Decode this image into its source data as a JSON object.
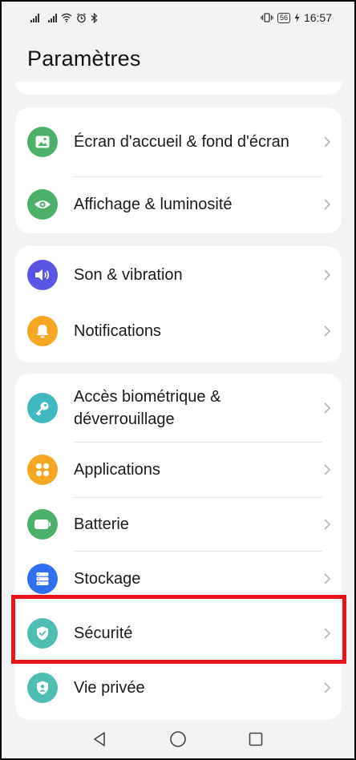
{
  "status_bar": {
    "battery_level": "56",
    "time": "16:57"
  },
  "header": {
    "title": "Paramètres"
  },
  "groups": [
    {
      "items": [
        {
          "label": "Écran d'accueil & fond d'écran",
          "icon": "wallpaper-icon",
          "color": "#4caf6a"
        },
        {
          "label": "Affichage & luminosité",
          "icon": "eye-icon",
          "color": "#4caf6a"
        }
      ]
    },
    {
      "items": [
        {
          "label": "Son & vibration",
          "icon": "speaker-icon",
          "color": "#5b55e6"
        },
        {
          "label": "Notifications",
          "icon": "bell-icon",
          "color": "#f5a623"
        }
      ]
    },
    {
      "items": [
        {
          "label": "Accès biométrique & déverrouillage",
          "icon": "key-icon",
          "color": "#3fb8c0"
        },
        {
          "label": "Applications",
          "icon": "apps-grid-icon",
          "color": "#f5a623"
        },
        {
          "label": "Batterie",
          "icon": "battery-icon",
          "color": "#4caf6a"
        },
        {
          "label": "Stockage",
          "icon": "storage-icon",
          "color": "#2f6ff0"
        },
        {
          "label": "Sécurité",
          "icon": "shield-check-icon",
          "color": "#4fbdb2"
        },
        {
          "label": "Vie privée",
          "icon": "privacy-icon",
          "color": "#4fbdb2"
        }
      ]
    }
  ],
  "nav_bar": {
    "icons": [
      "back-icon",
      "home-icon",
      "recents-icon"
    ]
  },
  "colors": {
    "background": "#f1f3f5",
    "card": "#ffffff",
    "highlight": "#e8141c"
  }
}
